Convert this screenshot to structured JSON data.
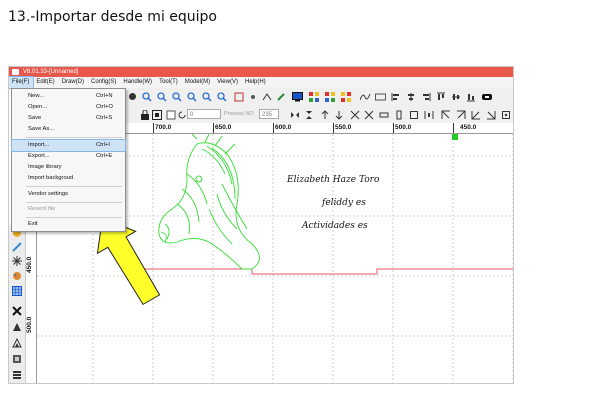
{
  "page": {
    "heading": "13.-Importar desde mi equipo"
  },
  "window": {
    "title": "V8.01.33-[Unnamed]"
  },
  "menubar": {
    "items": [
      {
        "label": "File(F)"
      },
      {
        "label": "Edit(E)"
      },
      {
        "label": "Draw(D)"
      },
      {
        "label": "Config(S)"
      },
      {
        "label": "Handle(W)"
      },
      {
        "label": "Tool(T)"
      },
      {
        "label": "Model(M)"
      },
      {
        "label": "View(V)"
      },
      {
        "label": "Help(H)"
      }
    ]
  },
  "file_menu": {
    "items": [
      {
        "label": "New...",
        "shortcut": "Ctrl+N"
      },
      {
        "label": "Open...",
        "shortcut": "Ctrl+O"
      },
      {
        "label": "Save",
        "shortcut": "Ctrl+S"
      },
      {
        "label": "Save As...",
        "shortcut": ""
      },
      {
        "label": "Import...",
        "shortcut": "Ctrl+I",
        "highlighted": true
      },
      {
        "label": "Export...",
        "shortcut": "Ctrl+E"
      },
      {
        "label": "Image library",
        "shortcut": ""
      },
      {
        "label": "Import backgroud",
        "shortcut": ""
      },
      {
        "label": "Vendor settings",
        "shortcut": ""
      },
      {
        "label": "Resent file",
        "shortcut": "",
        "disabled": true
      },
      {
        "label": "Exit",
        "shortcut": ""
      }
    ]
  },
  "toolbar": {
    "process_no_label": "Process NO",
    "process_no_value": "235",
    "counter_value": "0"
  },
  "ruler": {
    "h_labels": [
      "700.0",
      "650.0",
      "600.0",
      "550.0",
      "500.0",
      "450.0"
    ],
    "v_labels": [
      "450.0",
      "500.0"
    ]
  },
  "design_text": {
    "line1": "Elizabeth Haze Toro",
    "line2": "feliddy es",
    "line3": "Actividades es"
  },
  "colors": {
    "titlebar": "#e8574b",
    "design_outline": "#e85560",
    "zebra": "#33dd33",
    "arrow_fill": "#ffff2a",
    "grid": "#c4c4c4"
  }
}
